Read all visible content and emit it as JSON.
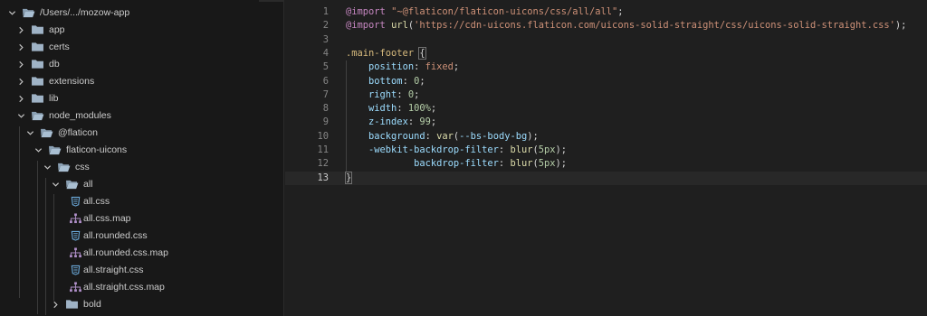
{
  "explorer": {
    "root": {
      "label": "/Users/.../mozow-app"
    },
    "items": [
      {
        "label": "app",
        "type": "folder",
        "open": false
      },
      {
        "label": "certs",
        "type": "folder",
        "open": false
      },
      {
        "label": "db",
        "type": "folder",
        "open": false
      },
      {
        "label": "extensions",
        "type": "folder",
        "open": false
      },
      {
        "label": "lib",
        "type": "folder",
        "open": false
      },
      {
        "label": "node_modules",
        "type": "folder",
        "open": true
      },
      {
        "label": "@flaticon",
        "type": "folder",
        "open": true
      },
      {
        "label": "flaticon-uicons",
        "type": "folder",
        "open": true
      },
      {
        "label": "css",
        "type": "folder",
        "open": true
      },
      {
        "label": "all",
        "type": "folder",
        "open": true
      },
      {
        "label": "all.css",
        "type": "css-file"
      },
      {
        "label": "all.css.map",
        "type": "map-file"
      },
      {
        "label": "all.rounded.css",
        "type": "css-file"
      },
      {
        "label": "all.rounded.css.map",
        "type": "map-file"
      },
      {
        "label": "all.straight.css",
        "type": "css-file"
      },
      {
        "label": "all.straight.css.map",
        "type": "map-file"
      },
      {
        "label": "bold",
        "type": "folder",
        "open": false
      }
    ]
  },
  "editor": {
    "current_line": 13,
    "lines": [
      {
        "num": "1",
        "tokens": [
          {
            "t": "@import",
            "c": "kw"
          },
          {
            "t": " ",
            "c": "punc"
          },
          {
            "t": "\"~@flaticon/flaticon-uicons/css/all/all\"",
            "c": "str"
          },
          {
            "t": ";",
            "c": "punc"
          }
        ]
      },
      {
        "num": "2",
        "tokens": [
          {
            "t": "@import",
            "c": "kw"
          },
          {
            "t": " ",
            "c": "punc"
          },
          {
            "t": "url",
            "c": "fn"
          },
          {
            "t": "(",
            "c": "punc"
          },
          {
            "t": "'https://cdn-uicons.flaticon.com/uicons-solid-straight/css/uicons-solid-straight.css'",
            "c": "str"
          },
          {
            "t": ");",
            "c": "punc"
          }
        ]
      },
      {
        "num": "3",
        "tokens": []
      },
      {
        "num": "4",
        "tokens": [
          {
            "t": ".main-footer",
            "c": "sel"
          },
          {
            "t": " ",
            "c": "punc"
          },
          {
            "t": "{",
            "c": "brace"
          }
        ]
      },
      {
        "num": "5",
        "tokens": [
          {
            "t": "    ",
            "c": "punc"
          },
          {
            "t": "position",
            "c": "prop"
          },
          {
            "t": ": ",
            "c": "punc"
          },
          {
            "t": "fixed",
            "c": "str"
          },
          {
            "t": ";",
            "c": "punc"
          }
        ]
      },
      {
        "num": "6",
        "tokens": [
          {
            "t": "    ",
            "c": "punc"
          },
          {
            "t": "bottom",
            "c": "prop"
          },
          {
            "t": ": ",
            "c": "punc"
          },
          {
            "t": "0",
            "c": "num"
          },
          {
            "t": ";",
            "c": "punc"
          }
        ]
      },
      {
        "num": "7",
        "tokens": [
          {
            "t": "    ",
            "c": "punc"
          },
          {
            "t": "right",
            "c": "prop"
          },
          {
            "t": ": ",
            "c": "punc"
          },
          {
            "t": "0",
            "c": "num"
          },
          {
            "t": ";",
            "c": "punc"
          }
        ]
      },
      {
        "num": "8",
        "tokens": [
          {
            "t": "    ",
            "c": "punc"
          },
          {
            "t": "width",
            "c": "prop"
          },
          {
            "t": ": ",
            "c": "punc"
          },
          {
            "t": "100%",
            "c": "num"
          },
          {
            "t": ";",
            "c": "punc"
          }
        ]
      },
      {
        "num": "9",
        "tokens": [
          {
            "t": "    ",
            "c": "punc"
          },
          {
            "t": "z-index",
            "c": "prop"
          },
          {
            "t": ": ",
            "c": "punc"
          },
          {
            "t": "99",
            "c": "num"
          },
          {
            "t": ";",
            "c": "punc"
          }
        ]
      },
      {
        "num": "10",
        "tokens": [
          {
            "t": "    ",
            "c": "punc"
          },
          {
            "t": "background",
            "c": "prop"
          },
          {
            "t": ": ",
            "c": "punc"
          },
          {
            "t": "var",
            "c": "fn"
          },
          {
            "t": "(",
            "c": "punc"
          },
          {
            "t": "--bs-body-bg",
            "c": "prop"
          },
          {
            "t": ");",
            "c": "punc"
          }
        ]
      },
      {
        "num": "11",
        "tokens": [
          {
            "t": "    ",
            "c": "punc"
          },
          {
            "t": "-webkit-backdrop-filter",
            "c": "prop"
          },
          {
            "t": ": ",
            "c": "punc"
          },
          {
            "t": "blur",
            "c": "fn"
          },
          {
            "t": "(",
            "c": "punc"
          },
          {
            "t": "5px",
            "c": "num"
          },
          {
            "t": ");",
            "c": "punc"
          }
        ]
      },
      {
        "num": "12",
        "tokens": [
          {
            "t": "            ",
            "c": "punc"
          },
          {
            "t": "backdrop-filter",
            "c": "prop"
          },
          {
            "t": ": ",
            "c": "punc"
          },
          {
            "t": "blur",
            "c": "fn"
          },
          {
            "t": "(",
            "c": "punc"
          },
          {
            "t": "5px",
            "c": "num"
          },
          {
            "t": ");",
            "c": "punc"
          }
        ]
      },
      {
        "num": "13",
        "tokens": [
          {
            "t": "}",
            "c": "brace"
          }
        ]
      }
    ]
  }
}
